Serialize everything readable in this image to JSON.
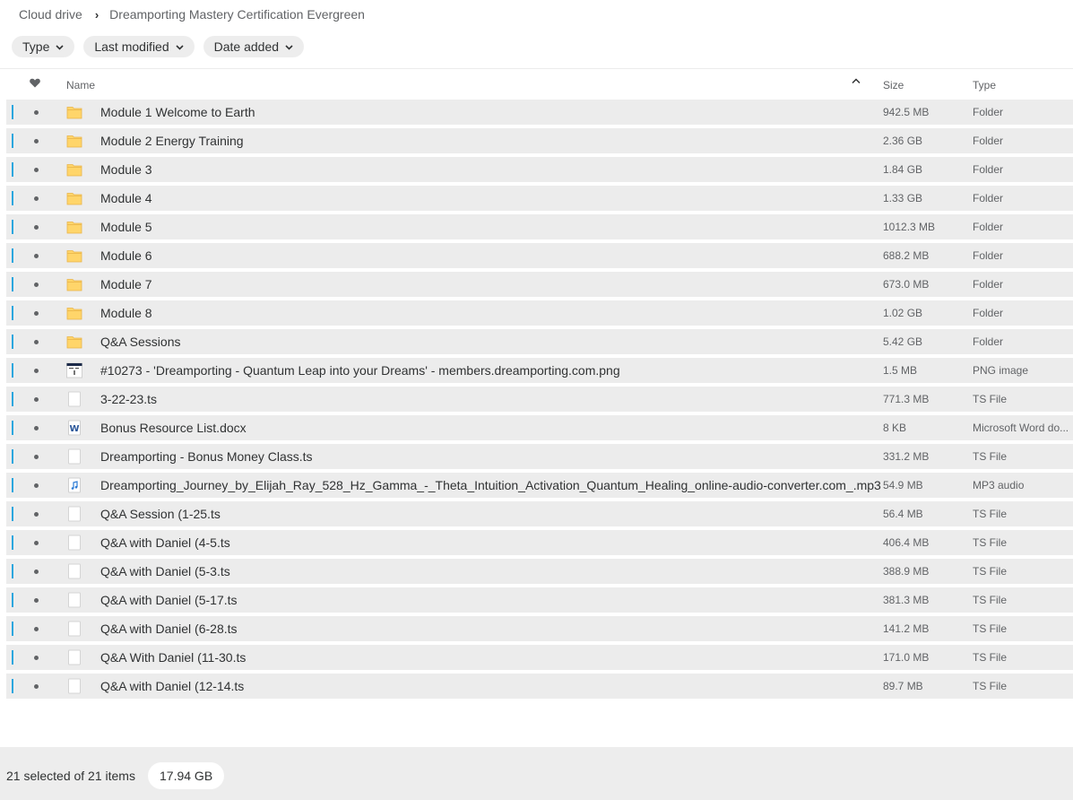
{
  "breadcrumb": {
    "root": "Cloud drive",
    "current": "Dreamporting Mastery Certification Evergreen"
  },
  "filters": [
    {
      "label": "Type"
    },
    {
      "label": "Last modified"
    },
    {
      "label": "Date added"
    }
  ],
  "columns": {
    "name": "Name",
    "size": "Size",
    "type": "Type"
  },
  "colors": {
    "accent": "#2ba6de",
    "folder": "#ffd56a",
    "row_bg": "#ececec"
  },
  "rows": [
    {
      "name": "Module 1 Welcome to Earth",
      "size": "942.5 MB",
      "type": "Folder",
      "icon": "folder-icon"
    },
    {
      "name": "Module 2 Energy Training",
      "size": "2.36 GB",
      "type": "Folder",
      "icon": "folder-icon"
    },
    {
      "name": "Module 3",
      "size": "1.84 GB",
      "type": "Folder",
      "icon": "folder-icon"
    },
    {
      "name": "Module 4",
      "size": "1.33 GB",
      "type": "Folder",
      "icon": "folder-icon"
    },
    {
      "name": "Module 5",
      "size": "1012.3 MB",
      "type": "Folder",
      "icon": "folder-icon"
    },
    {
      "name": "Module 6",
      "size": "688.2 MB",
      "type": "Folder",
      "icon": "folder-icon"
    },
    {
      "name": "Module 7",
      "size": "673.0 MB",
      "type": "Folder",
      "icon": "folder-icon"
    },
    {
      "name": "Module 8",
      "size": "1.02 GB",
      "type": "Folder",
      "icon": "folder-icon"
    },
    {
      "name": "Q&A Sessions",
      "size": "5.42 GB",
      "type": "Folder",
      "icon": "folder-icon"
    },
    {
      "name": "#10273 - 'Dreamporting - Quantum Leap into your Dreams' - members.dreamporting.com.png",
      "size": "1.5 MB",
      "type": "PNG image",
      "icon": "image-thumbnail-icon"
    },
    {
      "name": "3-22-23.ts",
      "size": "771.3 MB",
      "type": "TS File",
      "icon": "file-icon"
    },
    {
      "name": "Bonus Resource List.docx",
      "size": "8 KB",
      "type": "Microsoft Word do...",
      "icon": "word-document-icon"
    },
    {
      "name": "Dreamporting - Bonus Money Class.ts",
      "size": "331.2 MB",
      "type": "TS File",
      "icon": "file-icon"
    },
    {
      "name": "Dreamporting_Journey_by_Elijah_Ray_528_Hz_Gamma_-_Theta_Intuition_Activation_Quantum_Healing_online-audio-converter.com_.mp3",
      "size": "54.9 MB",
      "type": "MP3 audio",
      "icon": "audio-file-icon"
    },
    {
      "name": "Q&A Session (1-25.ts",
      "size": "56.4 MB",
      "type": "TS File",
      "icon": "file-icon"
    },
    {
      "name": "Q&A with Daniel (4-5.ts",
      "size": "406.4 MB",
      "type": "TS File",
      "icon": "file-icon"
    },
    {
      "name": "Q&A with Daniel (5-3.ts",
      "size": "388.9 MB",
      "type": "TS File",
      "icon": "file-icon"
    },
    {
      "name": "Q&A with Daniel (5-17.ts",
      "size": "381.3 MB",
      "type": "TS File",
      "icon": "file-icon"
    },
    {
      "name": "Q&A with Daniel (6-28.ts",
      "size": "141.2 MB",
      "type": "TS File",
      "icon": "file-icon"
    },
    {
      "name": "Q&A With Daniel (11-30.ts",
      "size": "171.0 MB",
      "type": "TS File",
      "icon": "file-icon"
    },
    {
      "name": "Q&A with Daniel (12-14.ts",
      "size": "89.7 MB",
      "type": "TS File",
      "icon": "file-icon"
    }
  ],
  "footer": {
    "selection": "21 selected of 21 items",
    "total_size": "17.94 GB"
  }
}
